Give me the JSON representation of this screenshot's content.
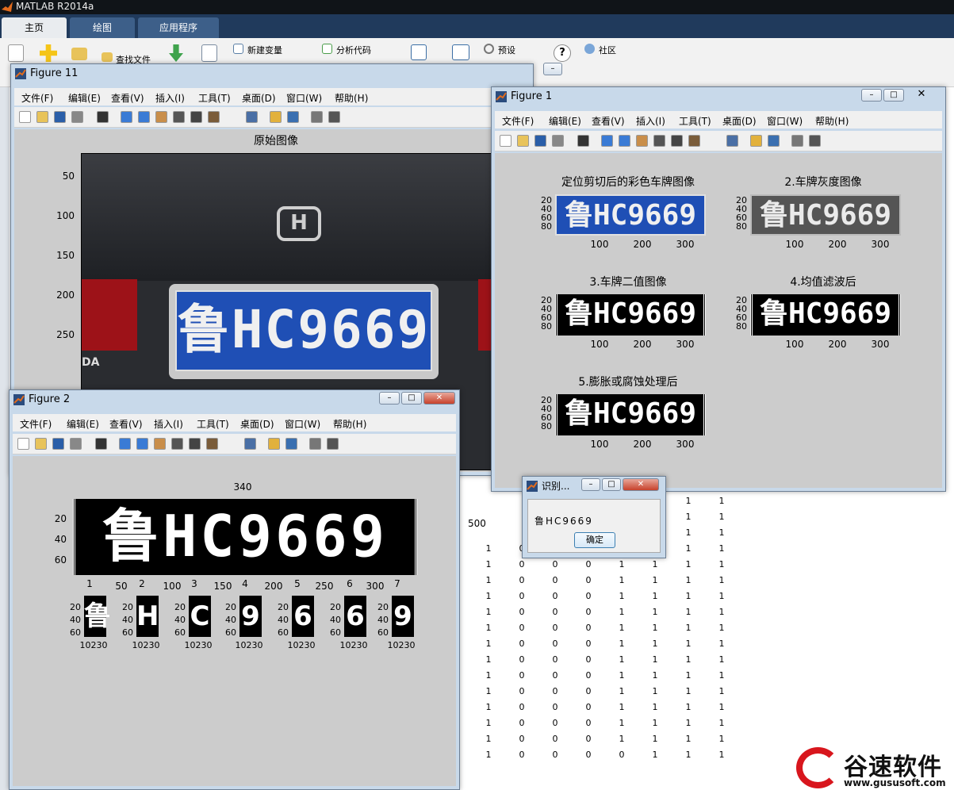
{
  "app": {
    "title": "MATLAB R2014a"
  },
  "ribbon_tabs": [
    "主页",
    "绘图",
    "应用程序"
  ],
  "ribbon": {
    "find_files": "查找文件",
    "new_variable": "新建变量",
    "analyze_code": "分析代码",
    "preferences": "预设",
    "community": "社区"
  },
  "menu": [
    "文件(F)",
    "编辑(E)",
    "查看(V)",
    "插入(I)",
    "工具(T)",
    "桌面(D)",
    "窗口(W)",
    "帮助(H)"
  ],
  "fig11": {
    "title": "Figure 11",
    "axes_title": "原始图像",
    "yticks": [
      "50",
      "100",
      "150",
      "200",
      "250"
    ],
    "xtick_500": "500",
    "plate_text": "鲁HC9669",
    "car_brand": "DA"
  },
  "fig1": {
    "title": "Figure 1",
    "titles": [
      "定位剪切后的彩色车牌图像",
      "2.车牌灰度图像",
      "3.车牌二值图像",
      "4.均值滤波后",
      "5.膨胀或腐蚀处理后"
    ],
    "yticks": [
      "20",
      "40",
      "60",
      "80"
    ],
    "xticks": [
      "100",
      "200",
      "300"
    ],
    "plate_text": "鲁HC9669"
  },
  "fig2": {
    "title": "Figure 2",
    "top_xlabel": "340",
    "yticks": [
      "20",
      "40",
      "60"
    ],
    "xticks": [
      "50",
      "100",
      "150",
      "200",
      "250",
      "300"
    ],
    "plate_text": "鲁HC9669",
    "char_titles": [
      "1",
      "2",
      "3",
      "4",
      "5",
      "6",
      "7"
    ],
    "chars": [
      "鲁",
      "H",
      "C",
      "9",
      "6",
      "6",
      "9"
    ],
    "char_yticks": [
      "20",
      "40",
      "60"
    ],
    "char_xlabel": "10230"
  },
  "dialog": {
    "title": "识别...",
    "result": "鲁HC9669",
    "ok": "确定"
  },
  "matrix": {
    "rows": [
      [
        "1",
        "1"
      ],
      [
        "1",
        "1"
      ],
      [
        "1",
        "1"
      ],
      [
        "1",
        "0",
        "0",
        "0",
        "1",
        "1",
        "1",
        "1"
      ],
      [
        "1",
        "0",
        "0",
        "0",
        "1",
        "1",
        "1",
        "1"
      ],
      [
        "1",
        "0",
        "0",
        "0",
        "1",
        "1",
        "1",
        "1"
      ],
      [
        "1",
        "0",
        "0",
        "0",
        "1",
        "1",
        "1",
        "1"
      ],
      [
        "1",
        "0",
        "0",
        "0",
        "1",
        "1",
        "1",
        "1"
      ],
      [
        "1",
        "0",
        "0",
        "0",
        "1",
        "1",
        "1",
        "1"
      ],
      [
        "1",
        "0",
        "0",
        "0",
        "1",
        "1",
        "1",
        "1"
      ],
      [
        "1",
        "0",
        "0",
        "0",
        "1",
        "1",
        "1",
        "1"
      ],
      [
        "1",
        "0",
        "0",
        "0",
        "1",
        "1",
        "1",
        "1"
      ],
      [
        "1",
        "0",
        "0",
        "0",
        "1",
        "1",
        "1",
        "1"
      ],
      [
        "1",
        "0",
        "0",
        "0",
        "1",
        "1",
        "1",
        "1"
      ],
      [
        "1",
        "0",
        "0",
        "0",
        "1",
        "1",
        "1",
        "1"
      ],
      [
        "1",
        "0",
        "0",
        "0",
        "1",
        "1",
        "1",
        "1"
      ],
      [
        "1",
        "0",
        "0",
        "0",
        "0",
        "1",
        "1",
        "1"
      ]
    ]
  },
  "watermark": {
    "name": "谷速软件",
    "url": "www.gususoft.com"
  },
  "colors": {
    "plate_blue": "#1f4fb5",
    "title_bar": "#c8d9ea",
    "figure_bg": "#cccccc"
  }
}
